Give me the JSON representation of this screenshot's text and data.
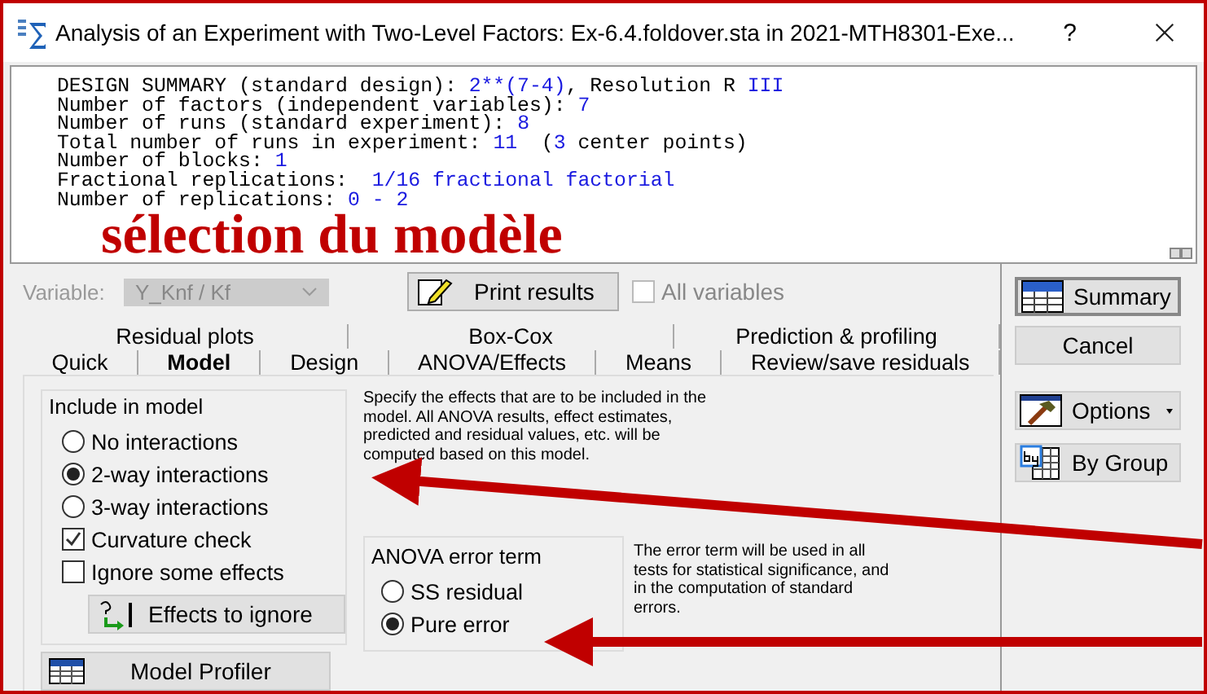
{
  "window": {
    "title": "Analysis of an Experiment with Two-Level Factors: Ex-6.4.foldover.sta in 2021-MTH8301-Exe...",
    "help": "?"
  },
  "summary_lines": [
    [
      {
        "kind": "label",
        "text": "DESIGN SUMMARY (standard design): "
      },
      {
        "kind": "value",
        "text": "2**(7-4)"
      },
      {
        "kind": "label",
        "text": ", Resolution R "
      },
      {
        "kind": "value",
        "text": "III"
      }
    ],
    [
      {
        "kind": "label",
        "text": "Number of factors (independent variables): "
      },
      {
        "kind": "value",
        "text": "7"
      }
    ],
    [
      {
        "kind": "label",
        "text": "Number of runs (standard experiment): "
      },
      {
        "kind": "value",
        "text": "8"
      }
    ],
    [
      {
        "kind": "label",
        "text": "Total number of runs in experiment: "
      },
      {
        "kind": "value",
        "text": "11"
      },
      {
        "kind": "label",
        "text": "  ("
      },
      {
        "kind": "value",
        "text": "3"
      },
      {
        "kind": "label",
        "text": " center points)"
      }
    ],
    [
      {
        "kind": "label",
        "text": "Number of blocks: "
      },
      {
        "kind": "value",
        "text": "1"
      }
    ],
    [
      {
        "kind": "label",
        "text": "Fractional replications:  "
      },
      {
        "kind": "value",
        "text": "1/16 fractional factorial"
      }
    ],
    [
      {
        "kind": "label",
        "text": "Number of replications: "
      },
      {
        "kind": "value",
        "text": "0 - 2"
      }
    ]
  ],
  "variable": {
    "label": "Variable:",
    "value": "Y_Knf / Kf",
    "disabled": true
  },
  "print_button": "Print results",
  "all_variables": {
    "label": "All variables",
    "checked": false,
    "disabled": true
  },
  "tab_rows": [
    [
      {
        "label": "Residual plots",
        "selected": false
      },
      {
        "label": "Box-Cox",
        "selected": false
      },
      {
        "label": "Prediction & profiling",
        "selected": false
      }
    ],
    [
      {
        "label": "Quick",
        "selected": false
      },
      {
        "label": "Model",
        "selected": true
      },
      {
        "label": "Design",
        "selected": false
      },
      {
        "label": "ANOVA/Effects",
        "selected": false
      },
      {
        "label": "Means",
        "selected": false
      },
      {
        "label": "Review/save residuals",
        "selected": false
      }
    ]
  ],
  "include_group": {
    "title": "Include in model",
    "options": [
      {
        "kind": "radio",
        "label": "No interactions",
        "selected": false
      },
      {
        "kind": "radio",
        "label": "2-way interactions",
        "selected": true
      },
      {
        "kind": "radio",
        "label": "3-way interactions",
        "selected": false
      },
      {
        "kind": "checkbox",
        "label": "Curvature check",
        "checked": true
      },
      {
        "kind": "checkbox",
        "label": "Ignore some effects",
        "checked": false
      }
    ],
    "button": "Effects to ignore"
  },
  "model_profiler": "Model Profiler",
  "model_note": "Specify the effects that are to be included in the model.  All ANOVA results, effect estimates, predicted and residual values, etc. will be computed based on this model.",
  "error_group": {
    "title": "ANOVA error term",
    "options": [
      {
        "label": "SS residual",
        "selected": false
      },
      {
        "label": "Pure error",
        "selected": true
      }
    ]
  },
  "error_note": "The error term will be used in all tests for statistical significance, and in the computation of standard errors.",
  "side_buttons": [
    {
      "kind": "summary",
      "label": "Summary"
    },
    {
      "kind": "plain",
      "label": "Cancel"
    },
    {
      "kind": "options",
      "label": "Options"
    },
    {
      "kind": "group",
      "label": "By Group"
    }
  ],
  "annotation": {
    "text": "sélection du modèle"
  }
}
